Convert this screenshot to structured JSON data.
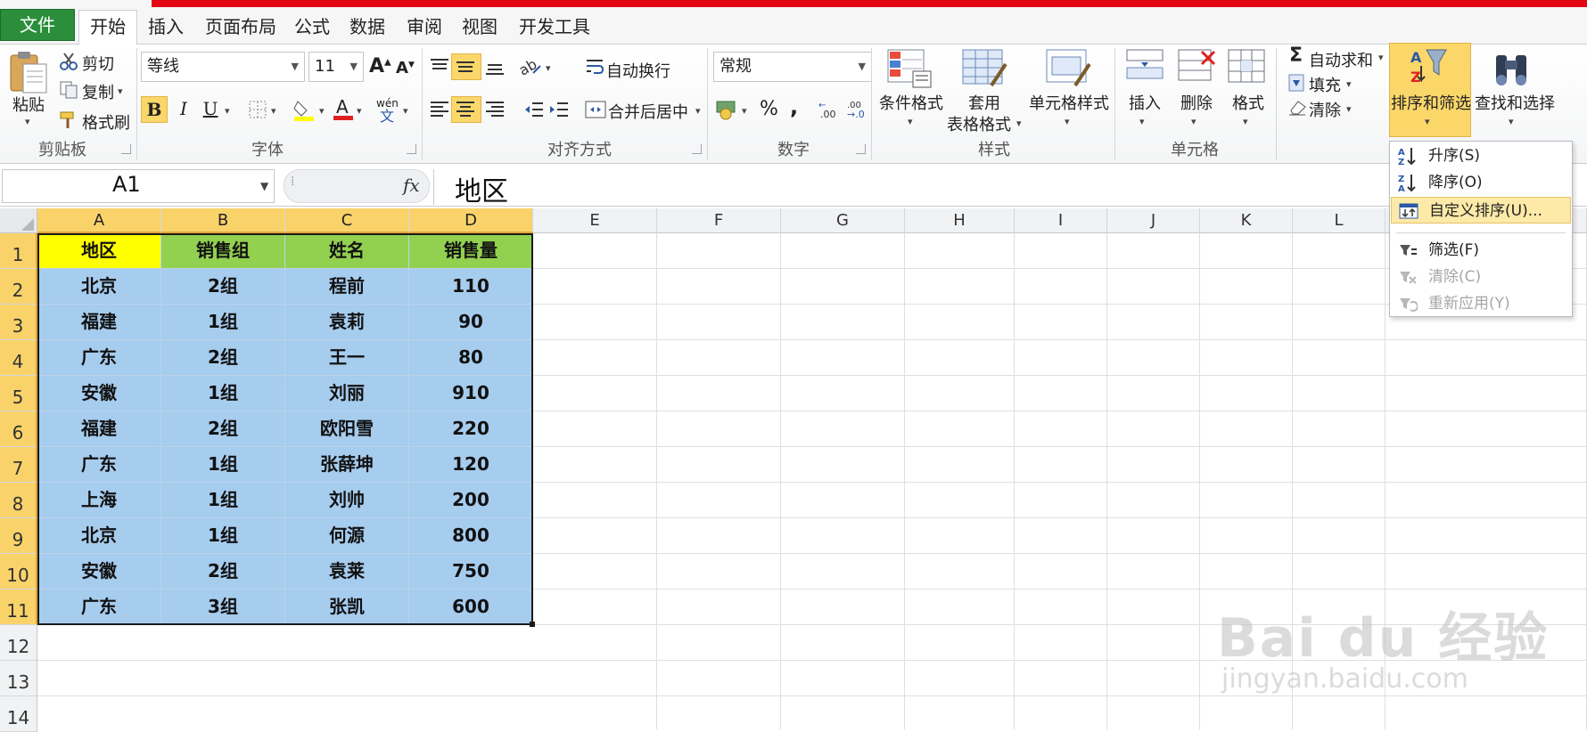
{
  "tabs": [
    {
      "label": "文件"
    },
    {
      "label": "开始"
    },
    {
      "label": "插入"
    },
    {
      "label": "页面布局"
    },
    {
      "label": "公式"
    },
    {
      "label": "数据"
    },
    {
      "label": "审阅"
    },
    {
      "label": "视图"
    },
    {
      "label": "开发工具"
    }
  ],
  "ribbon": {
    "clipboard": {
      "paste": "粘贴",
      "cut": "剪切",
      "copy": "复制",
      "format_painter": "格式刷",
      "group": "剪贴板"
    },
    "font": {
      "name": "等线",
      "size": "11",
      "bold": "B",
      "italic": "I",
      "underline": "U",
      "group": "字体"
    },
    "alignment": {
      "wrap": "自动换行",
      "merge": "合并后居中",
      "group": "对齐方式"
    },
    "number": {
      "format": "常规",
      "percent": "%",
      "comma": ",",
      "group": "数字"
    },
    "styles": {
      "conditional": "条件格式",
      "table_line1": "套用",
      "table_line2": "表格格式",
      "cell_styles": "单元格样式",
      "group": "样式"
    },
    "cells": {
      "insert": "插入",
      "delete": "删除",
      "format": "格式",
      "group": "单元格"
    },
    "editing": {
      "autosum": "自动求和",
      "fill": "填充",
      "clear": "清除",
      "sort_filter": "排序和筛选",
      "find_select": "查找和选择"
    }
  },
  "formula_bar": {
    "name_box": "A1",
    "fx": "fx",
    "value": "地区"
  },
  "columns": [
    "A",
    "B",
    "C",
    "D",
    "E",
    "F",
    "G",
    "H",
    "I",
    "J",
    "K",
    "L"
  ],
  "rows": [
    "1",
    "2",
    "3",
    "4",
    "5",
    "6",
    "7",
    "8",
    "9",
    "10",
    "11",
    "12",
    "13",
    "14"
  ],
  "table": {
    "headers": [
      "地区",
      "销售组",
      "姓名",
      "销售量"
    ],
    "rows": [
      [
        "北京",
        "2组",
        "程前",
        "110"
      ],
      [
        "福建",
        "1组",
        "袁莉",
        "90"
      ],
      [
        "广东",
        "2组",
        "王一",
        "80"
      ],
      [
        "安徽",
        "1组",
        "刘丽",
        "910"
      ],
      [
        "福建",
        "2组",
        "欧阳雪",
        "220"
      ],
      [
        "广东",
        "1组",
        "张薛坤",
        "120"
      ],
      [
        "上海",
        "1组",
        "刘帅",
        "200"
      ],
      [
        "北京",
        "1组",
        "何源",
        "800"
      ],
      [
        "安徽",
        "2组",
        "袁莱",
        "750"
      ],
      [
        "广东",
        "3组",
        "张凯",
        "600"
      ]
    ]
  },
  "sort_menu": {
    "items": [
      {
        "label": "升序(S)",
        "enabled": true
      },
      {
        "label": "降序(O)",
        "enabled": true
      },
      {
        "label": "自定义排序(U)...",
        "enabled": true,
        "highlighted": true
      },
      {
        "label": "筛选(F)",
        "enabled": true
      },
      {
        "label": "清除(C)",
        "enabled": false
      },
      {
        "label": "重新应用(Y)",
        "enabled": false
      }
    ]
  },
  "watermark": {
    "brand": "Bai du 经验",
    "url": "jingyan.baidu.com"
  },
  "colors": {
    "file_tab": "#2a8e3a",
    "header_yellow": "#ffff00",
    "header_green": "#92d050",
    "data_blue": "#a6ccee",
    "selection_highlight": "#f9d36a",
    "menu_highlight": "#fde9a8"
  }
}
